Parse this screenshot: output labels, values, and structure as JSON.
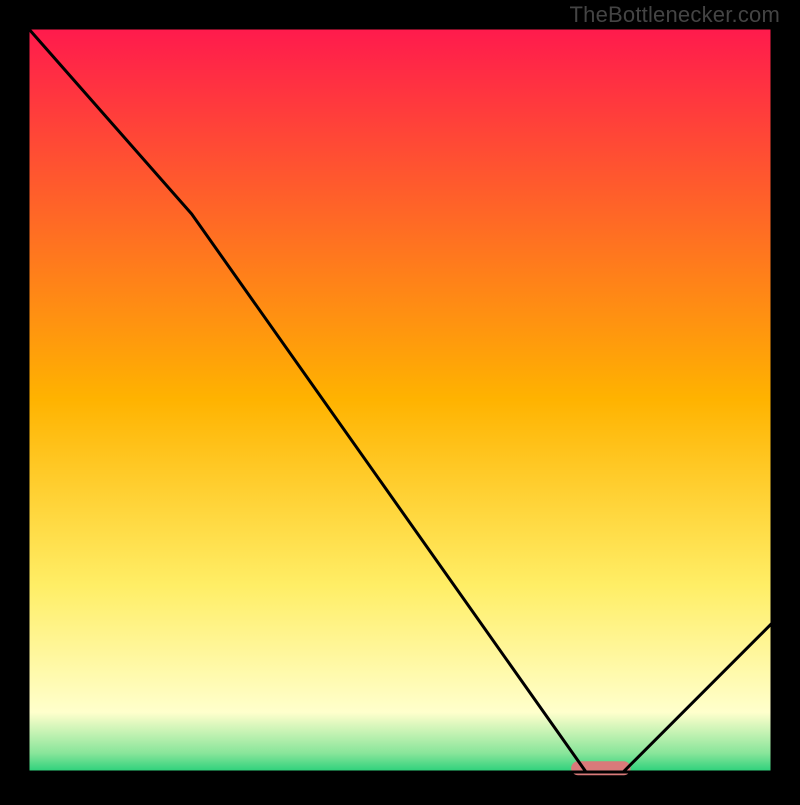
{
  "watermark": "TheBottlenecker.com",
  "chart_data": {
    "type": "line",
    "title": "",
    "xlabel": "",
    "ylabel": "",
    "xlim": [
      0,
      100
    ],
    "ylim": [
      0,
      100
    ],
    "x": [
      0,
      22,
      75,
      80,
      100
    ],
    "values": [
      100,
      75,
      0,
      0,
      20
    ],
    "marker": {
      "x_start": 73,
      "x_end": 81,
      "y": 0.5
    },
    "grid": false,
    "legend": false,
    "background": "vertical-gradient",
    "gradient_stops": [
      {
        "pos": 0.0,
        "color": "#ff1a4d"
      },
      {
        "pos": 0.5,
        "color": "#ffb300"
      },
      {
        "pos": 0.75,
        "color": "#ffee66"
      },
      {
        "pos": 0.92,
        "color": "#ffffcc"
      },
      {
        "pos": 0.975,
        "color": "#88e59a"
      },
      {
        "pos": 1.0,
        "color": "#29d07a"
      }
    ],
    "frame_color": "#000000",
    "frame_inset": 28,
    "line_color": "#000000",
    "line_width": 3,
    "marker_color": "#d97a7a"
  }
}
